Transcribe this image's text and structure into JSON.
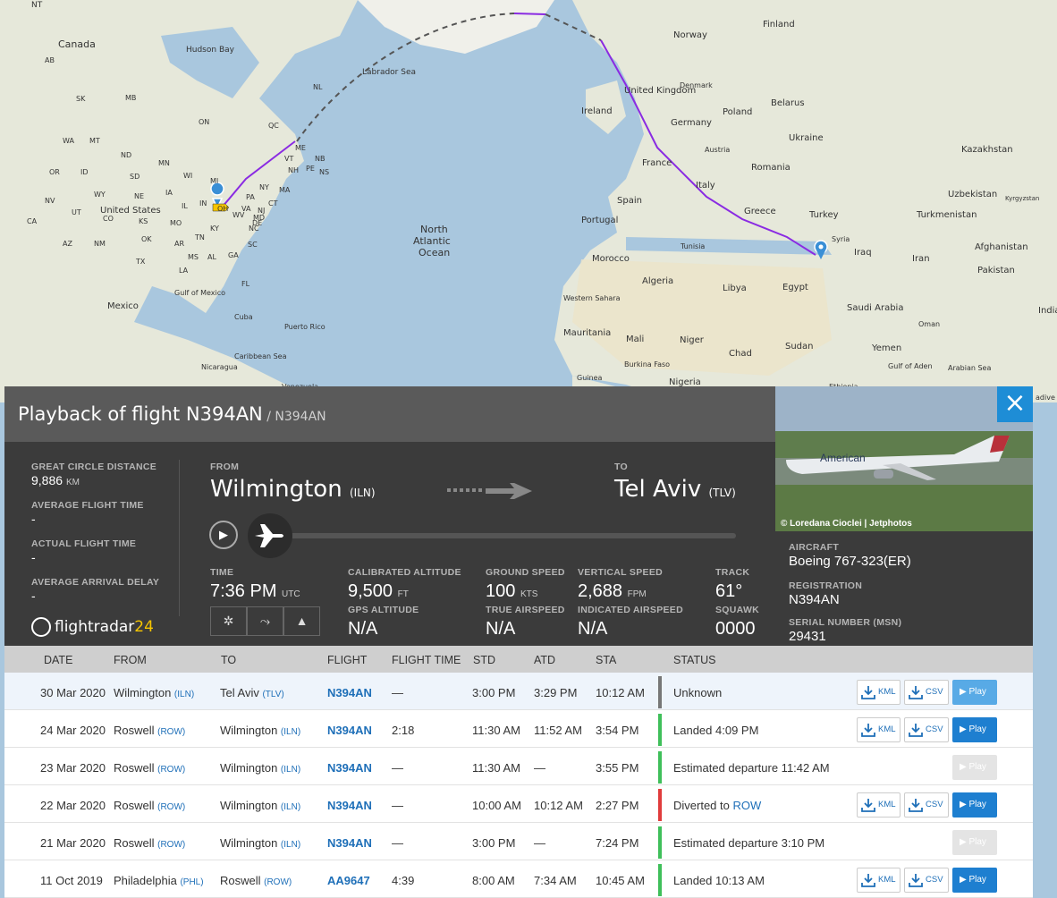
{
  "map": {
    "labels": [
      "NT",
      "Canada",
      "Hudson Bay",
      "Labrador Sea",
      "AB",
      "SK",
      "MB",
      "ON",
      "QC",
      "NL",
      "WA",
      "MT",
      "ND",
      "MN",
      "WI",
      "MI",
      "OR",
      "ID",
      "SD",
      "WY",
      "NE",
      "IA",
      "IL",
      "IN",
      "OH",
      "NV",
      "UT",
      "CO",
      "KS",
      "MO",
      "KY",
      "WV",
      "VA",
      "NC",
      "TN",
      "CA",
      "AZ",
      "NM",
      "OK",
      "AR",
      "TX",
      "LA",
      "MS",
      "AL",
      "GA",
      "SC",
      "FL",
      "PA",
      "NY",
      "VT",
      "NH",
      "ME",
      "MA",
      "CT",
      "NJ",
      "MD",
      "DE",
      "NB",
      "NS",
      "PE",
      "United States",
      "Mexico",
      "Gulf of Mexico",
      "Cuba",
      "Puerto Rico",
      "Caribbean Sea",
      "Nicaragua",
      "Venezuela",
      "North",
      "Atlantic",
      "Ocean",
      "Ireland",
      "United Kingdom",
      "Denmark",
      "Norway",
      "Finland",
      "Poland",
      "Belarus",
      "Germany",
      "Ukraine",
      "France",
      "Austria",
      "Romania",
      "Spain",
      "Italy",
      "Portugal",
      "Greece",
      "Turkey",
      "Kazakhstan",
      "Uzbekistan",
      "Kyrgyzstan",
      "Turkmenistan",
      "Afghanistan",
      "Pakistan",
      "India",
      "Iran",
      "Iraq",
      "Syria",
      "Morocco",
      "Tunisia",
      "Algeria",
      "Libya",
      "Egypt",
      "Saudi Arabia",
      "Oman",
      "Yemen",
      "Gulf of Aden",
      "Arabian Sea",
      "Western Sahara",
      "Mauritania",
      "Mali",
      "Niger",
      "Chad",
      "Sudan",
      "Burkina Faso",
      "Guinea",
      "Nigeria",
      "Ethiopia",
      "adive"
    ]
  },
  "panel": {
    "title": "Playback of flight N394AN",
    "subtitle": " / N394AN",
    "close_icon": "×",
    "photo_credit": "© Loredana Cioclei | Jetphotos",
    "livery_text": "American",
    "stats": {
      "gcd_label": "GREAT CIRCLE DISTANCE",
      "gcd_value": "9,886",
      "gcd_unit": "KM",
      "aft_label": "AVERAGE FLIGHT TIME",
      "aft_value": "-",
      "act_label": "ACTUAL FLIGHT TIME",
      "act_value": "-",
      "aad_label": "AVERAGE ARRIVAL DELAY",
      "aad_value": "-"
    },
    "from_label": "FROM",
    "from_city": "Wilmington",
    "from_code": "(ILN)",
    "to_label": "TO",
    "to_city": "Tel Aviv",
    "to_code": "(TLV)",
    "time_label": "TIME",
    "time_value": "7:36 PM",
    "time_unit": "UTC",
    "calt_label": "CALIBRATED ALTITUDE",
    "calt_value": "9,500",
    "calt_unit": "FT",
    "gps_label": "GPS ALTITUDE",
    "gps_value": "N/A",
    "gs_label": "GROUND SPEED",
    "gs_value": "100",
    "gs_unit": "KTS",
    "tas_label": "TRUE AIRSPEED",
    "tas_value": "N/A",
    "vs_label": "VERTICAL SPEED",
    "vs_value": "2,688",
    "vs_unit": "FPM",
    "ias_label": "INDICATED AIRSPEED",
    "ias_value": "N/A",
    "track_label": "TRACK",
    "track_value": "61°",
    "squawk_label": "SQUAWK",
    "squawk_value": "0000",
    "logo_text": "flightradar",
    "logo_num": "24",
    "aircraft_label": "AIRCRAFT",
    "aircraft_value": "Boeing 767-323(ER)",
    "reg_label": "REGISTRATION",
    "reg_value": "N394AN",
    "msn_label": "SERIAL NUMBER (MSN)",
    "msn_value": "29431",
    "progress": 0.0
  },
  "table": {
    "headers": [
      "DATE",
      "FROM",
      "TO",
      "FLIGHT",
      "FLIGHT TIME",
      "STD",
      "ATD",
      "STA",
      "STATUS"
    ],
    "kml": "KML",
    "csv": "CSV",
    "play": "Play",
    "rows": [
      {
        "date": "30 Mar 2020",
        "from": "Wilmington",
        "from_code": "(ILN)",
        "to": "Tel Aviv",
        "to_code": "(TLV)",
        "flight": "N394AN",
        "ftime": "—",
        "std": "3:00 PM",
        "atd": "3:29 PM",
        "sta": "10:12 AM",
        "status": "Unknown",
        "status_link": "",
        "status_color": "#777777",
        "downloads": true,
        "play_state": "lite",
        "selected": true
      },
      {
        "date": "24 Mar 2020",
        "from": "Roswell",
        "from_code": "(ROW)",
        "to": "Wilmington",
        "to_code": "(ILN)",
        "flight": "N394AN",
        "ftime": "2:18",
        "std": "11:30 AM",
        "atd": "11:52 AM",
        "sta": "3:54 PM",
        "status": "Landed 4:09 PM",
        "status_link": "",
        "status_color": "#3fbf5a",
        "downloads": true,
        "play_state": "on",
        "selected": false
      },
      {
        "date": "23 Mar 2020",
        "from": "Roswell",
        "from_code": "(ROW)",
        "to": "Wilmington",
        "to_code": "(ILN)",
        "flight": "N394AN",
        "ftime": "—",
        "std": "11:30 AM",
        "atd": "—",
        "sta": "3:55 PM",
        "status": "Estimated departure 11:42 AM",
        "status_link": "",
        "status_color": "#3fbf5a",
        "downloads": false,
        "play_state": "off",
        "selected": false
      },
      {
        "date": "22 Mar 2020",
        "from": "Roswell",
        "from_code": "(ROW)",
        "to": "Wilmington",
        "to_code": "(ILN)",
        "flight": "N394AN",
        "ftime": "—",
        "std": "10:00 AM",
        "atd": "10:12 AM",
        "sta": "2:27 PM",
        "status": "Diverted to ",
        "status_link": "ROW",
        "status_color": "#e03c3c",
        "downloads": true,
        "play_state": "on",
        "selected": false
      },
      {
        "date": "21 Mar 2020",
        "from": "Roswell",
        "from_code": "(ROW)",
        "to": "Wilmington",
        "to_code": "(ILN)",
        "flight": "N394AN",
        "ftime": "—",
        "std": "3:00 PM",
        "atd": "—",
        "sta": "7:24 PM",
        "status": "Estimated departure 3:10 PM",
        "status_link": "",
        "status_color": "#3fbf5a",
        "downloads": false,
        "play_state": "off",
        "selected": false
      },
      {
        "date": "11 Oct 2019",
        "from": "Philadelphia",
        "from_code": "(PHL)",
        "to": "Roswell",
        "to_code": "(ROW)",
        "flight": "AA9647",
        "ftime": "4:39",
        "std": "8:00 AM",
        "atd": "7:34 AM",
        "sta": "10:45 AM",
        "status": "Landed 10:13 AM",
        "status_link": "",
        "status_color": "#3fbf5a",
        "downloads": true,
        "play_state": "on",
        "selected": false
      }
    ]
  }
}
